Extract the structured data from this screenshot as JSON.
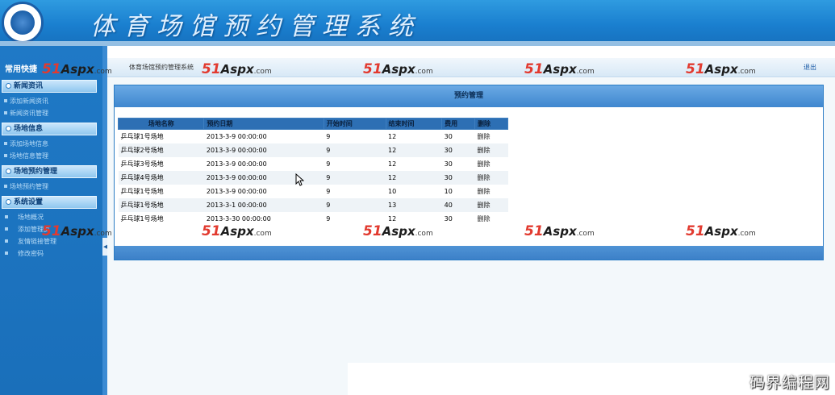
{
  "header": {
    "title": "体育场馆预约管理系统"
  },
  "sidebar": {
    "heading": "常用快捷",
    "groups": [
      {
        "label": "新闻资讯",
        "items": [
          "添加新闻资讯",
          "新闻资讯管理"
        ]
      },
      {
        "label": "场地信息",
        "items": [
          "添加场地信息",
          "场地信息管理"
        ]
      },
      {
        "label": "场地预约管理",
        "items": [
          "场地预约管理"
        ]
      },
      {
        "label": "系统设置",
        "items": [
          "场地概况",
          "添加管理员",
          "友情链接管理",
          "修改密码"
        ]
      }
    ]
  },
  "topbar": {
    "breadcrumb": "体育场馆预约管理系统",
    "logout": "退出"
  },
  "panel": {
    "title": "预约管理",
    "columns": [
      "场地名称",
      "预约日期",
      "开始时间",
      "结束时间",
      "费用",
      "删除"
    ],
    "rows": [
      [
        "乒乓球1号场地",
        "2013-3-9 00:00:00",
        "9",
        "12",
        "30",
        "删除"
      ],
      [
        "乒乓球2号场地",
        "2013-3-9 00:00:00",
        "9",
        "12",
        "30",
        "删除"
      ],
      [
        "乒乓球3号场地",
        "2013-3-9 00:00:00",
        "9",
        "12",
        "30",
        "删除"
      ],
      [
        "乒乓球4号场地",
        "2013-3-9 00:00:00",
        "9",
        "12",
        "30",
        "删除"
      ],
      [
        "乒乓球1号场地",
        "2013-3-9 00:00:00",
        "9",
        "10",
        "10",
        "删除"
      ],
      [
        "乒乓球1号场地",
        "2013-3-1 00:00:00",
        "9",
        "13",
        "40",
        "删除"
      ],
      [
        "乒乓球1号场地",
        "2013-3-30 00:00:00",
        "9",
        "12",
        "30",
        "删除"
      ]
    ]
  },
  "watermark": {
    "brand": "51",
    "brand2": "Aspx",
    "suffix": ".com"
  },
  "footer_mark": "码界编程网",
  "colors": {
    "banner": "#1a7fcf",
    "sidebar": "#1f79c6",
    "header_row": "#2d6fb4",
    "watermark": "#e23a2f"
  }
}
